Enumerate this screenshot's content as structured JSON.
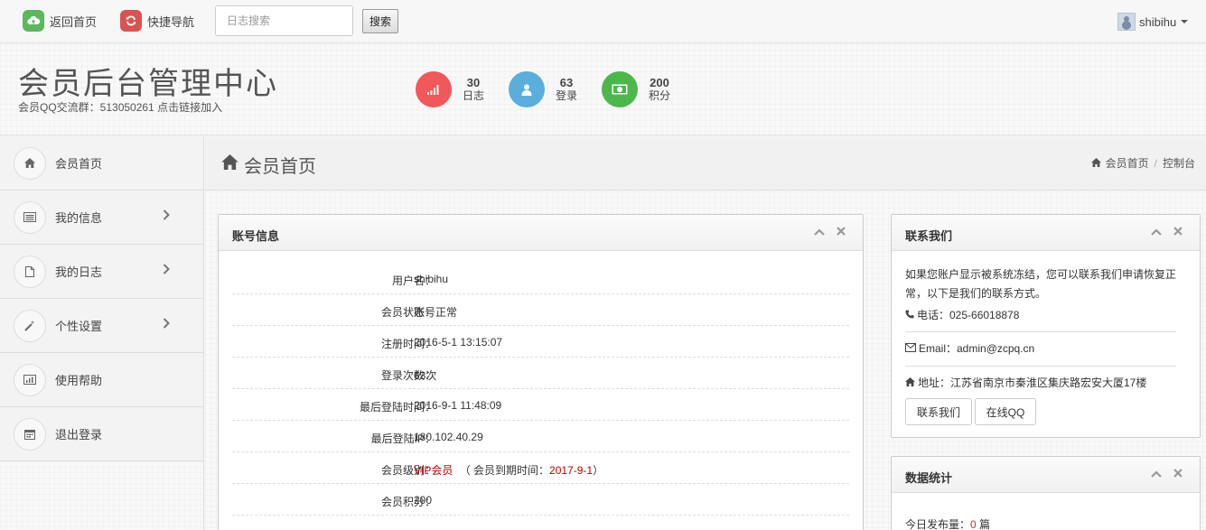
{
  "topbar": {
    "home_label": "返回首页",
    "nav_label": "快捷导航",
    "search_placeholder": "日志搜索",
    "search_button": "搜索",
    "username": "shibihu"
  },
  "header": {
    "title": "会员后台管理中心",
    "subtitle": "会员QQ交流群：513050261 点击链接加入",
    "stats": [
      {
        "value": "30",
        "label": "日志",
        "color": "#f0585a",
        "icon": "signal-icon"
      },
      {
        "value": "63",
        "label": "登录",
        "color": "#5aaedc",
        "icon": "user-icon"
      },
      {
        "value": "200",
        "label": "积分",
        "color": "#4cb84c",
        "icon": "money-icon"
      }
    ]
  },
  "sidebar": {
    "items": [
      {
        "label": "会员首页",
        "icon": "home-icon"
      },
      {
        "label": "我的信息",
        "icon": "list-icon"
      },
      {
        "label": "我的日志",
        "icon": "file-icon"
      },
      {
        "label": "个性设置",
        "icon": "magic-wand-icon"
      },
      {
        "label": "使用帮助",
        "icon": "chart-icon"
      },
      {
        "label": "退出登录",
        "icon": "calendar-icon"
      }
    ]
  },
  "page": {
    "title": "会员首页",
    "breadcrumb": [
      "会员首页",
      "控制台"
    ]
  },
  "account": {
    "title": "账号信息",
    "rows": [
      {
        "label": "用户名：",
        "value": "shibihu"
      },
      {
        "label": "会员状态：",
        "value": "账号正常"
      },
      {
        "label": "注册时间：",
        "value": "2016-5-1 13:15:07"
      },
      {
        "label": "登录次数：",
        "value": "63次"
      },
      {
        "label": "最后登陆时间：",
        "value": "2016-9-1 11:48:09"
      },
      {
        "label": "最后登陆IP：",
        "value": "180.102.40.29"
      },
      {
        "label": "会员级别：",
        "vip": "VIP会员",
        "expire_prefix": "（ 会员到期时间：",
        "expire_date": "2017-9-1",
        "expire_suffix": "）"
      },
      {
        "label": "会员积分：",
        "value": "200"
      }
    ]
  },
  "contact": {
    "title": "联系我们",
    "intro": "如果您账户显示被系统冻结，您可以联系我们申请恢复正常，以下是我们的联系方式。",
    "phone": "电话：025-66018878",
    "email": "Email：admin@zcpq.cn",
    "address": "地址：江苏省南京市秦淮区集庆路宏安大厦17楼",
    "btn_contact": "联系我们",
    "btn_qq": "在线QQ"
  },
  "stats_box": {
    "title": "数据统计",
    "today_label": "今日发布量：",
    "today_value": "0",
    "today_unit": "篇"
  },
  "colors": {
    "home_green": "#5cb85c",
    "nav_red": "#d9534f",
    "accent_red": "#c7254e"
  }
}
